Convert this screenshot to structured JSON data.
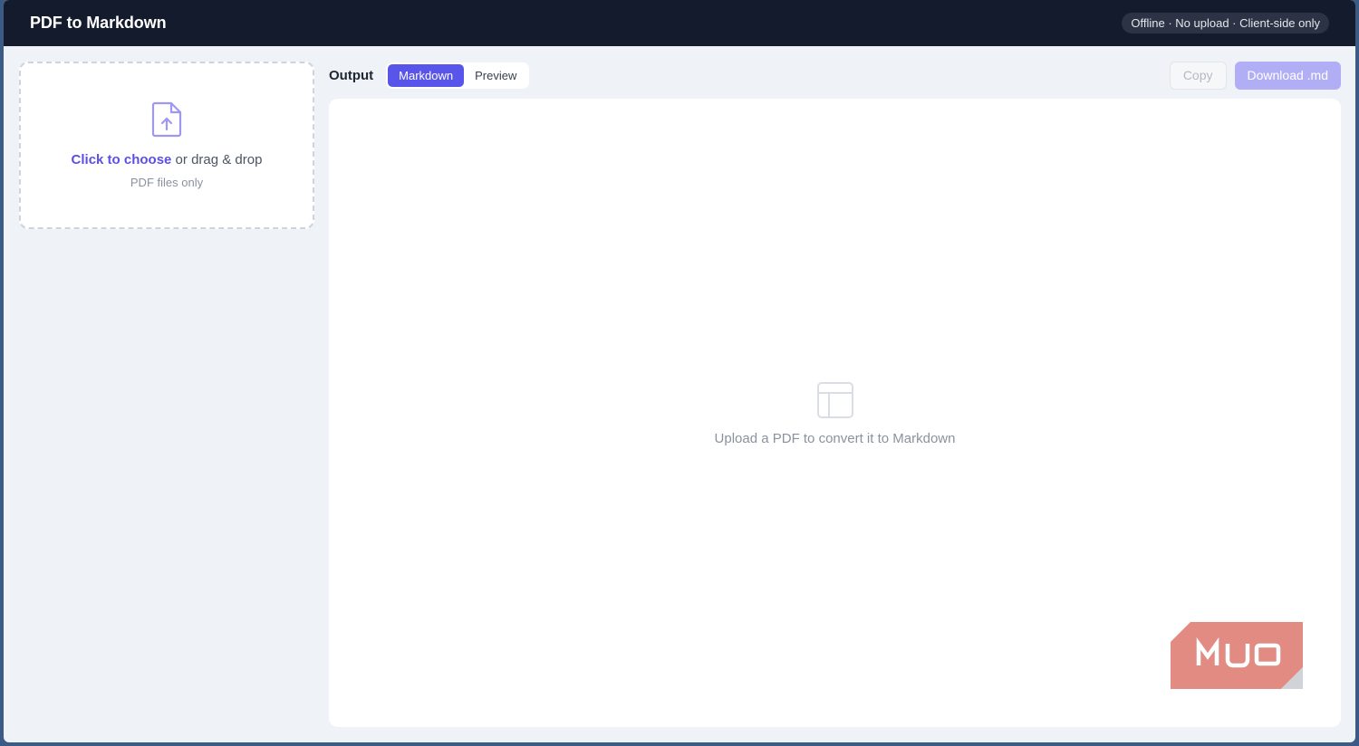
{
  "header": {
    "title": "PDF to Markdown",
    "status": "Offline · No upload · Client-side only"
  },
  "dropzone": {
    "link_text": "Click to choose",
    "rest_text": " or drag & drop",
    "sub_text": "PDF files only",
    "icon": "file-upload-icon"
  },
  "output": {
    "label": "Output",
    "tabs": [
      {
        "label": "Markdown",
        "active": true
      },
      {
        "label": "Preview",
        "active": false
      }
    ],
    "copy_label": "Copy",
    "download_label": "Download .md"
  },
  "empty_state": {
    "icon": "layout-icon",
    "message": "Upload a PDF to convert it to Markdown"
  },
  "watermark": {
    "text": "MUO"
  },
  "colors": {
    "accent": "#5a55ea",
    "header_bg": "#131b2d",
    "watermark": "#e0857c"
  }
}
